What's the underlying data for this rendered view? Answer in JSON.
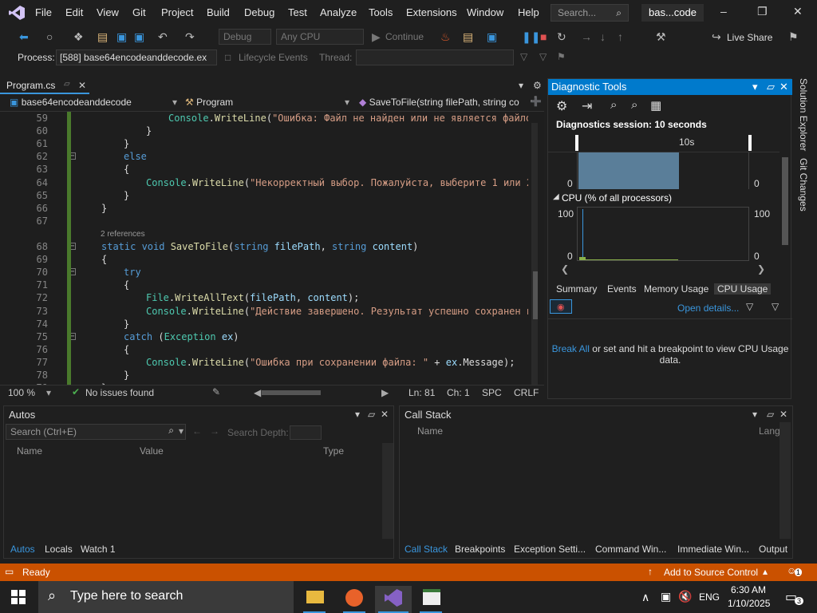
{
  "window": {
    "menu": [
      "File",
      "Edit",
      "View",
      "Git",
      "Project",
      "Build",
      "Debug",
      "Test",
      "Analyze",
      "Tools",
      "Extensions",
      "Window",
      "Help"
    ],
    "search_placeholder": "Search...",
    "solution_badge": "bas...code"
  },
  "toolbar": {
    "config": "Debug",
    "platform": "Any CPU",
    "continue_label": "Continue",
    "live_share": "Live Share",
    "process_label": "Process:",
    "process_value": "[588] base64encodeanddecode.ex",
    "lifecycle_label": "Lifecycle Events",
    "thread_label": "Thread:"
  },
  "editor": {
    "tab_name": "Program.cs",
    "nav_project": "base64encodeanddecode",
    "nav_class": "Program",
    "nav_member": "SaveToFile(string filePath, string co",
    "references": "2 references",
    "lines": [
      {
        "n": "59",
        "indent": 8,
        "parts": [
          {
            "t": "Console",
            "c": "ty"
          },
          {
            "t": ".",
            "c": ""
          },
          {
            "t": "WriteLine",
            "c": "me"
          },
          {
            "t": "(",
            "c": ""
          },
          {
            "t": "\"Ошибка: Файл не найден или не является файлом",
            "c": "st"
          }
        ]
      },
      {
        "n": "60",
        "indent": 6,
        "parts": [
          {
            "t": "}",
            "c": ""
          }
        ]
      },
      {
        "n": "61",
        "indent": 4,
        "parts": [
          {
            "t": "}",
            "c": ""
          }
        ]
      },
      {
        "n": "62",
        "indent": 4,
        "parts": [
          {
            "t": "else",
            "c": "kw"
          }
        ]
      },
      {
        "n": "63",
        "indent": 4,
        "parts": [
          {
            "t": "{",
            "c": ""
          }
        ]
      },
      {
        "n": "64",
        "indent": 6,
        "parts": [
          {
            "t": "Console",
            "c": "ty"
          },
          {
            "t": ".",
            "c": ""
          },
          {
            "t": "WriteLine",
            "c": "me"
          },
          {
            "t": "(",
            "c": ""
          },
          {
            "t": "\"Некорректный выбор. Пожалуйста, выберите 1 или 2.",
            "c": "st"
          }
        ]
      },
      {
        "n": "65",
        "indent": 4,
        "parts": [
          {
            "t": "}",
            "c": ""
          }
        ]
      },
      {
        "n": "66",
        "indent": 2,
        "parts": [
          {
            "t": "}",
            "c": ""
          }
        ]
      },
      {
        "n": "67",
        "indent": 0,
        "parts": []
      },
      {
        "n": "68",
        "indent": 2,
        "parts": [
          {
            "t": "static ",
            "c": "kw"
          },
          {
            "t": "void ",
            "c": "kw"
          },
          {
            "t": "SaveToFile",
            "c": "me"
          },
          {
            "t": "(",
            "c": ""
          },
          {
            "t": "string ",
            "c": "kw"
          },
          {
            "t": "filePath",
            "c": "pa"
          },
          {
            "t": ", ",
            "c": ""
          },
          {
            "t": "string ",
            "c": "kw"
          },
          {
            "t": "content",
            "c": "pa"
          },
          {
            "t": ")",
            "c": ""
          }
        ]
      },
      {
        "n": "69",
        "indent": 2,
        "parts": [
          {
            "t": "{",
            "c": ""
          }
        ]
      },
      {
        "n": "70",
        "indent": 4,
        "parts": [
          {
            "t": "try",
            "c": "kw"
          }
        ]
      },
      {
        "n": "71",
        "indent": 4,
        "parts": [
          {
            "t": "{",
            "c": ""
          }
        ]
      },
      {
        "n": "72",
        "indent": 6,
        "parts": [
          {
            "t": "File",
            "c": "ty"
          },
          {
            "t": ".",
            "c": ""
          },
          {
            "t": "WriteAllText",
            "c": "me"
          },
          {
            "t": "(",
            "c": ""
          },
          {
            "t": "filePath",
            "c": "pa"
          },
          {
            "t": ", ",
            "c": ""
          },
          {
            "t": "content",
            "c": "pa"
          },
          {
            "t": ");",
            "c": ""
          }
        ]
      },
      {
        "n": "73",
        "indent": 6,
        "parts": [
          {
            "t": "Console",
            "c": "ty"
          },
          {
            "t": ".",
            "c": ""
          },
          {
            "t": "WriteLine",
            "c": "me"
          },
          {
            "t": "(",
            "c": ""
          },
          {
            "t": "\"Действие завершено. Результат успешно сохранен в ф",
            "c": "st"
          }
        ]
      },
      {
        "n": "74",
        "indent": 4,
        "parts": [
          {
            "t": "}",
            "c": ""
          }
        ]
      },
      {
        "n": "75",
        "indent": 4,
        "parts": [
          {
            "t": "catch ",
            "c": "kw"
          },
          {
            "t": "(",
            "c": ""
          },
          {
            "t": "Exception ",
            "c": "ty"
          },
          {
            "t": "ex",
            "c": "pa"
          },
          {
            "t": ")",
            "c": ""
          }
        ]
      },
      {
        "n": "76",
        "indent": 4,
        "parts": [
          {
            "t": "{",
            "c": ""
          }
        ]
      },
      {
        "n": "77",
        "indent": 6,
        "parts": [
          {
            "t": "Console",
            "c": "ty"
          },
          {
            "t": ".",
            "c": ""
          },
          {
            "t": "WriteLine",
            "c": "me"
          },
          {
            "t": "(",
            "c": ""
          },
          {
            "t": "\"Ошибка при сохранении файла: \"",
            "c": "st"
          },
          {
            "t": " + ",
            "c": ""
          },
          {
            "t": "ex",
            "c": "pa"
          },
          {
            "t": ".Message);",
            "c": ""
          }
        ]
      },
      {
        "n": "78",
        "indent": 4,
        "parts": [
          {
            "t": "}",
            "c": ""
          }
        ]
      },
      {
        "n": "79",
        "indent": 2,
        "parts": [
          {
            "t": "}",
            "c": ""
          }
        ]
      }
    ],
    "status": {
      "zoom": "100 %",
      "issues": "No issues found",
      "line": "Ln: 81",
      "col": "Ch: 1",
      "spc": "SPC",
      "crlf": "CRLF"
    }
  },
  "diagnostics": {
    "title": "Diagnostic Tools",
    "session": "Diagnostics session: 10 seconds",
    "timeline_label": "10s",
    "events_left_zero": "0",
    "events_right_zero": "0",
    "cpu_title": "CPU (% of all processors)",
    "cpu_max_left": "100",
    "cpu_max_right": "100",
    "cpu_min_left": "0",
    "cpu_min_right": "0",
    "tabs": [
      "Summary",
      "Events",
      "Memory Usage",
      "CPU Usage"
    ],
    "open_details": "Open details...",
    "break_all": "Break All",
    "break_msg": " or set and hit a breakpoint to view CPU Usage",
    "break_msg2": "data."
  },
  "right_strip": {
    "solution_explorer": "Solution Explorer",
    "git_changes": "Git Changes"
  },
  "autos": {
    "title": "Autos",
    "search_placeholder": "Search (Ctrl+E)",
    "search_depth": "Search Depth:",
    "columns": [
      "Name",
      "Value",
      "Type"
    ],
    "tabs": [
      "Autos",
      "Locals",
      "Watch 1"
    ]
  },
  "callstack": {
    "title": "Call Stack",
    "columns": [
      "Name",
      "Lang"
    ],
    "tabs": [
      "Call Stack",
      "Breakpoints",
      "Exception Setti...",
      "Command Win...",
      "Immediate Win...",
      "Output"
    ]
  },
  "statusbar": {
    "ready": "Ready",
    "source_control": "Add to Source Control",
    "notif_count": "1"
  },
  "taskbar": {
    "search": "Type here to search",
    "lang": "ENG",
    "time": "6:30 AM",
    "date": "1/10/2025",
    "notif": "3"
  },
  "colors": {
    "accent": "#007acc",
    "status": "#ca5100",
    "brand": "#8661c5"
  }
}
